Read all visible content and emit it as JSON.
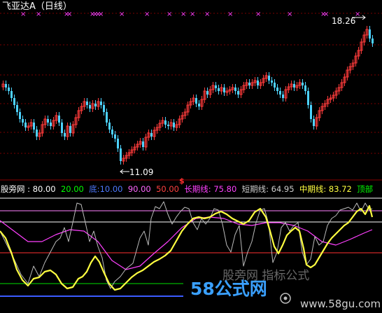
{
  "title": "飞亚达A（日线）",
  "marker_symbol": "×",
  "price_high_label": "18.26",
  "price_low_label": "11.09",
  "event_marker": "$",
  "indicator": {
    "name": "股旁网",
    "items": [
      {
        "label": "",
        "value": "80.00",
        "color": "#ffffff"
      },
      {
        "label": "",
        "value": "20.00",
        "color": "#00ff00"
      },
      {
        "label": "底:",
        "value": "10.00",
        "color": "#4d79ff"
      },
      {
        "label": "",
        "value": "90.00",
        "color": "#ff66ff"
      },
      {
        "label": "",
        "value": "50.00",
        "color": "#ff4040"
      },
      {
        "label": "长期线:",
        "value": "75.80",
        "color": "#ff40ff"
      },
      {
        "label": "短期线:",
        "value": "64.95",
        "color": "#cccccc"
      },
      {
        "label": "中期线:",
        "value": "83.72",
        "color": "#ffff40"
      },
      {
        "label": "顶部",
        "value": "",
        "color": "#00ff00"
      }
    ]
  },
  "watermark": {
    "brand": "58公式网",
    "url": "www.58gu.com",
    "overlay_text": "股旁网 指标公式"
  },
  "colors": {
    "up": "#ff3b3b",
    "down": "#4dd2ff",
    "grid": "#8b0000",
    "marker": "#ff40ff"
  }
}
